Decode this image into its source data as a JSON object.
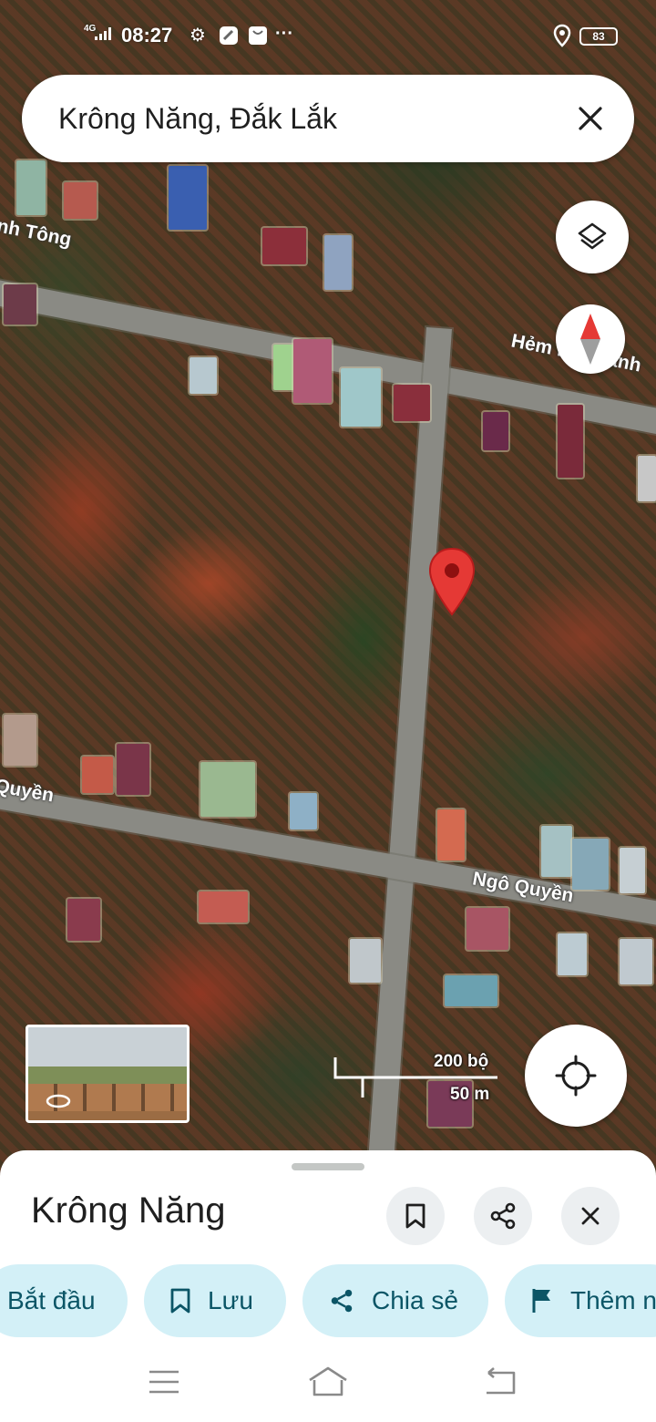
{
  "status_bar": {
    "network": "4G",
    "time": "08:27",
    "more": "···",
    "battery": "83",
    "icons": [
      "gear-icon",
      "edit-icon",
      "bag-icon",
      "location-icon"
    ]
  },
  "search": {
    "query": "Krông Năng, Đắk Lắk"
  },
  "map": {
    "streets": [
      "nh Tông",
      "Hẻm Lê Thánh",
      "Quyền",
      "Ngô Quyền"
    ],
    "scale": {
      "imperial": "200 bộ",
      "metric": "50 m"
    },
    "colors": {
      "pin": "#e53935",
      "compass_north": "#e53935"
    }
  },
  "sheet": {
    "title": "Krông Năng",
    "chips": {
      "start": "Bắt đầu",
      "save": "Lưu",
      "share": "Chia sẻ",
      "add": "Thêm n"
    },
    "accent": "#d3f0f7"
  }
}
